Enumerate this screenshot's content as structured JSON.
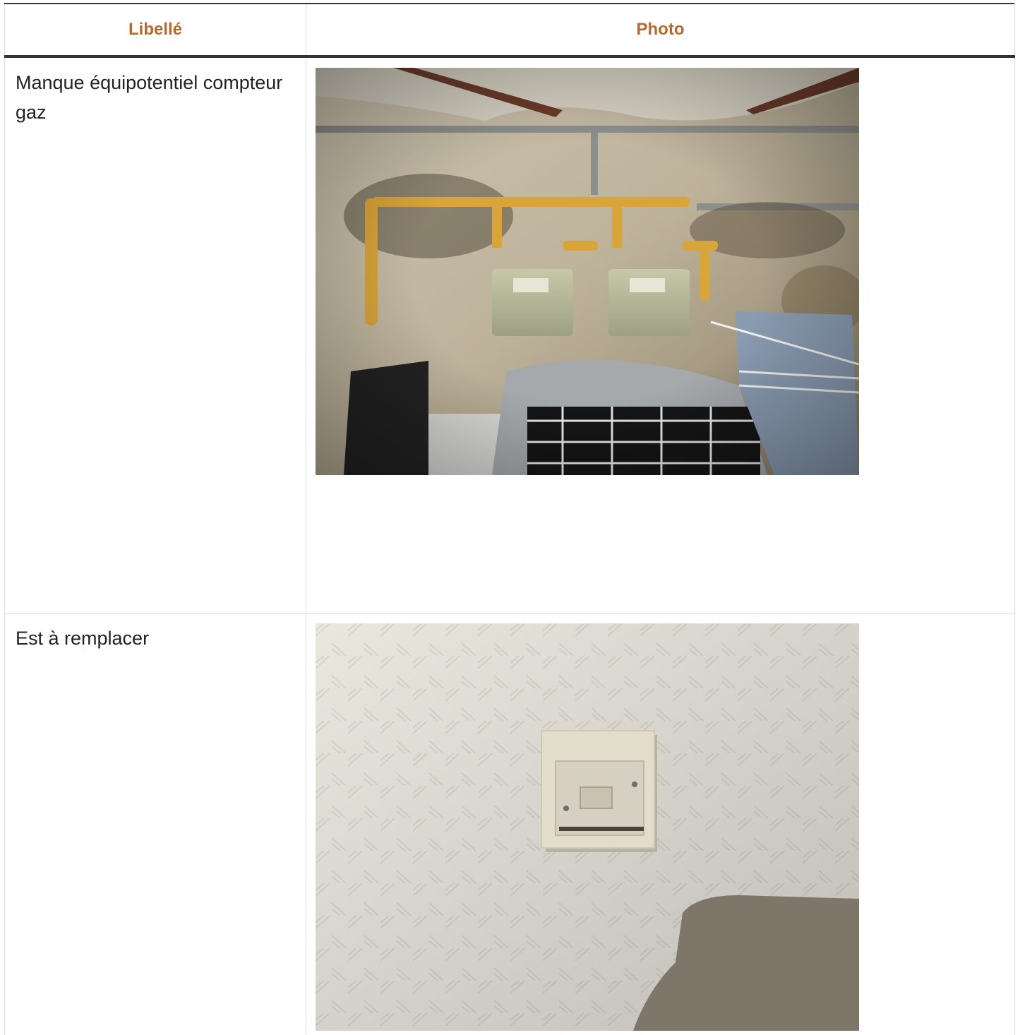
{
  "table": {
    "headers": [
      "Libellé",
      "Photo"
    ],
    "rows": [
      {
        "label": "Manque équipotentiel compteur gaz",
        "photo_subject": "gas-meters-basement-photo"
      },
      {
        "label": "Est à remplacer",
        "photo_subject": "wall-switch-photo"
      }
    ]
  },
  "colors": {
    "header_text": "#b46a2f",
    "rule": "#333333",
    "grid": "#dcdcdc"
  }
}
